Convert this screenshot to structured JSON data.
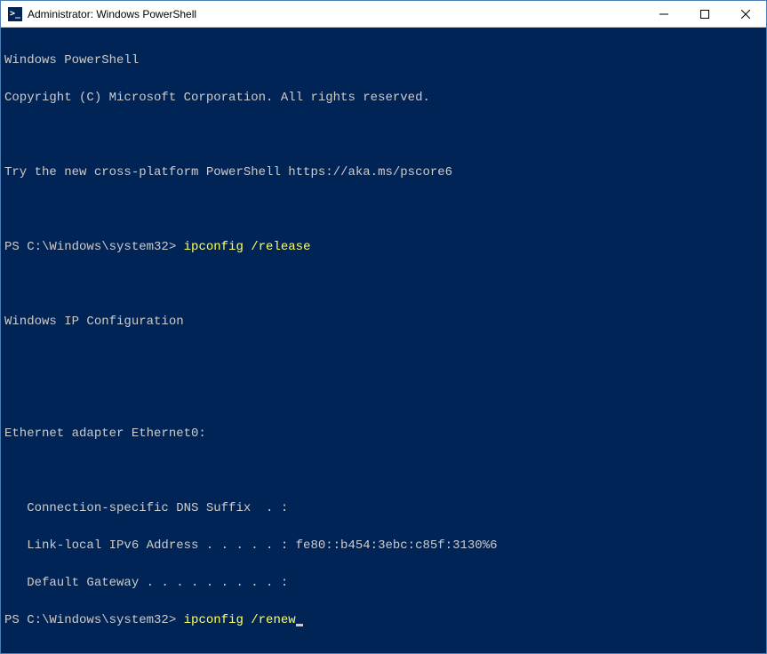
{
  "window": {
    "title": "Administrator: Windows PowerShell",
    "icon_glyph": ">_"
  },
  "terminal": {
    "line1": "Windows PowerShell",
    "line2": "Copyright (C) Microsoft Corporation. All rights reserved.",
    "line3": "",
    "line4": "Try the new cross-platform PowerShell https://aka.ms/pscore6",
    "line5": "",
    "prompt1": "PS C:\\Windows\\system32> ",
    "cmd1": "ipconfig /release",
    "line7": "",
    "line8": "Windows IP Configuration",
    "line9": "",
    "line10": "",
    "line11": "Ethernet adapter Ethernet0:",
    "line12": "",
    "line13": "   Connection-specific DNS Suffix  . :",
    "line14": "   Link-local IPv6 Address . . . . . : fe80::b454:3ebc:c85f:3130%6",
    "line15": "   Default Gateway . . . . . . . . . :",
    "prompt2": "PS C:\\Windows\\system32> ",
    "cmd2": "ipconfig /renew"
  }
}
